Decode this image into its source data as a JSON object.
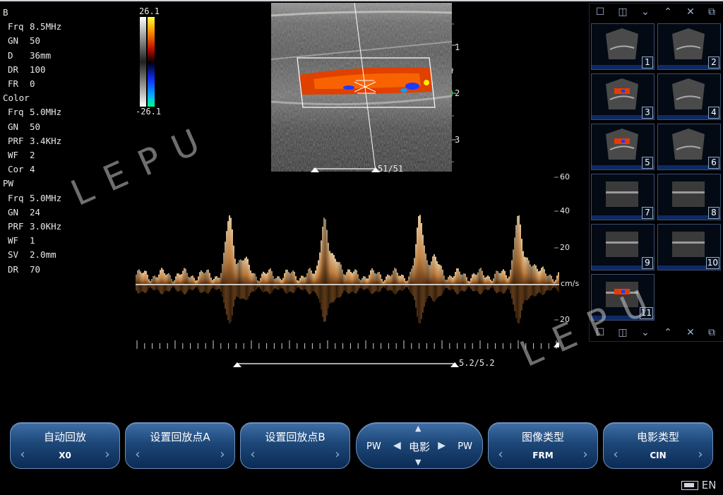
{
  "params": {
    "b_header": "B",
    "b": [
      {
        "k": "Frq",
        "v": "8.5MHz"
      },
      {
        "k": "GN",
        "v": "50"
      },
      {
        "k": "D",
        "v": "36mm"
      },
      {
        "k": "DR",
        "v": "100"
      },
      {
        "k": "FR",
        "v": "0"
      }
    ],
    "color_header": "Color",
    "color": [
      {
        "k": "Frq",
        "v": "5.0MHz"
      },
      {
        "k": "GN",
        "v": "50"
      },
      {
        "k": "PRF",
        "v": "3.4KHz"
      },
      {
        "k": "WF",
        "v": "2"
      },
      {
        "k": "Cor",
        "v": "4"
      }
    ],
    "pw_header": "PW",
    "pw": [
      {
        "k": "Frq",
        "v": "5.0MHz"
      },
      {
        "k": "GN",
        "v": "24"
      },
      {
        "k": "PRF",
        "v": "3.0KHz"
      },
      {
        "k": "WF",
        "v": "1"
      },
      {
        "k": "SV",
        "v": "2.0mm"
      },
      {
        "k": "DR",
        "v": "70"
      }
    ]
  },
  "colorbar": {
    "top": "26.1",
    "bottom": "-26.1"
  },
  "bmode": {
    "depth_marks": [
      "1",
      "2",
      "3"
    ],
    "frame": "51/51"
  },
  "spectrum": {
    "vel_marks": [
      "60",
      "40",
      "20",
      "cm/s",
      "20"
    ],
    "frame": "5.2/5.2"
  },
  "thumbnails": [
    "1",
    "2",
    "3",
    "4",
    "5",
    "6",
    "7",
    "8",
    "9",
    "10",
    "11"
  ],
  "watermark": "LEPU",
  "buttons": {
    "auto_replay": {
      "title": "自动回放",
      "value": "X0"
    },
    "set_point_a": {
      "title": "设置回放点A",
      "value": ""
    },
    "set_point_b": {
      "title": "设置回放点B",
      "value": ""
    },
    "cine": {
      "left": "PW",
      "center": "电影",
      "right": "PW"
    },
    "image_type": {
      "title": "图像类型",
      "value": "FRM"
    },
    "cine_type": {
      "title": "电影类型",
      "value": "CIN"
    }
  },
  "status": {
    "lang": "EN"
  },
  "colors": {
    "accent": "#1d4778",
    "flow_red": "#e83a00",
    "flow_blue": "#1a3cff",
    "spectrum": "#d9904a"
  }
}
